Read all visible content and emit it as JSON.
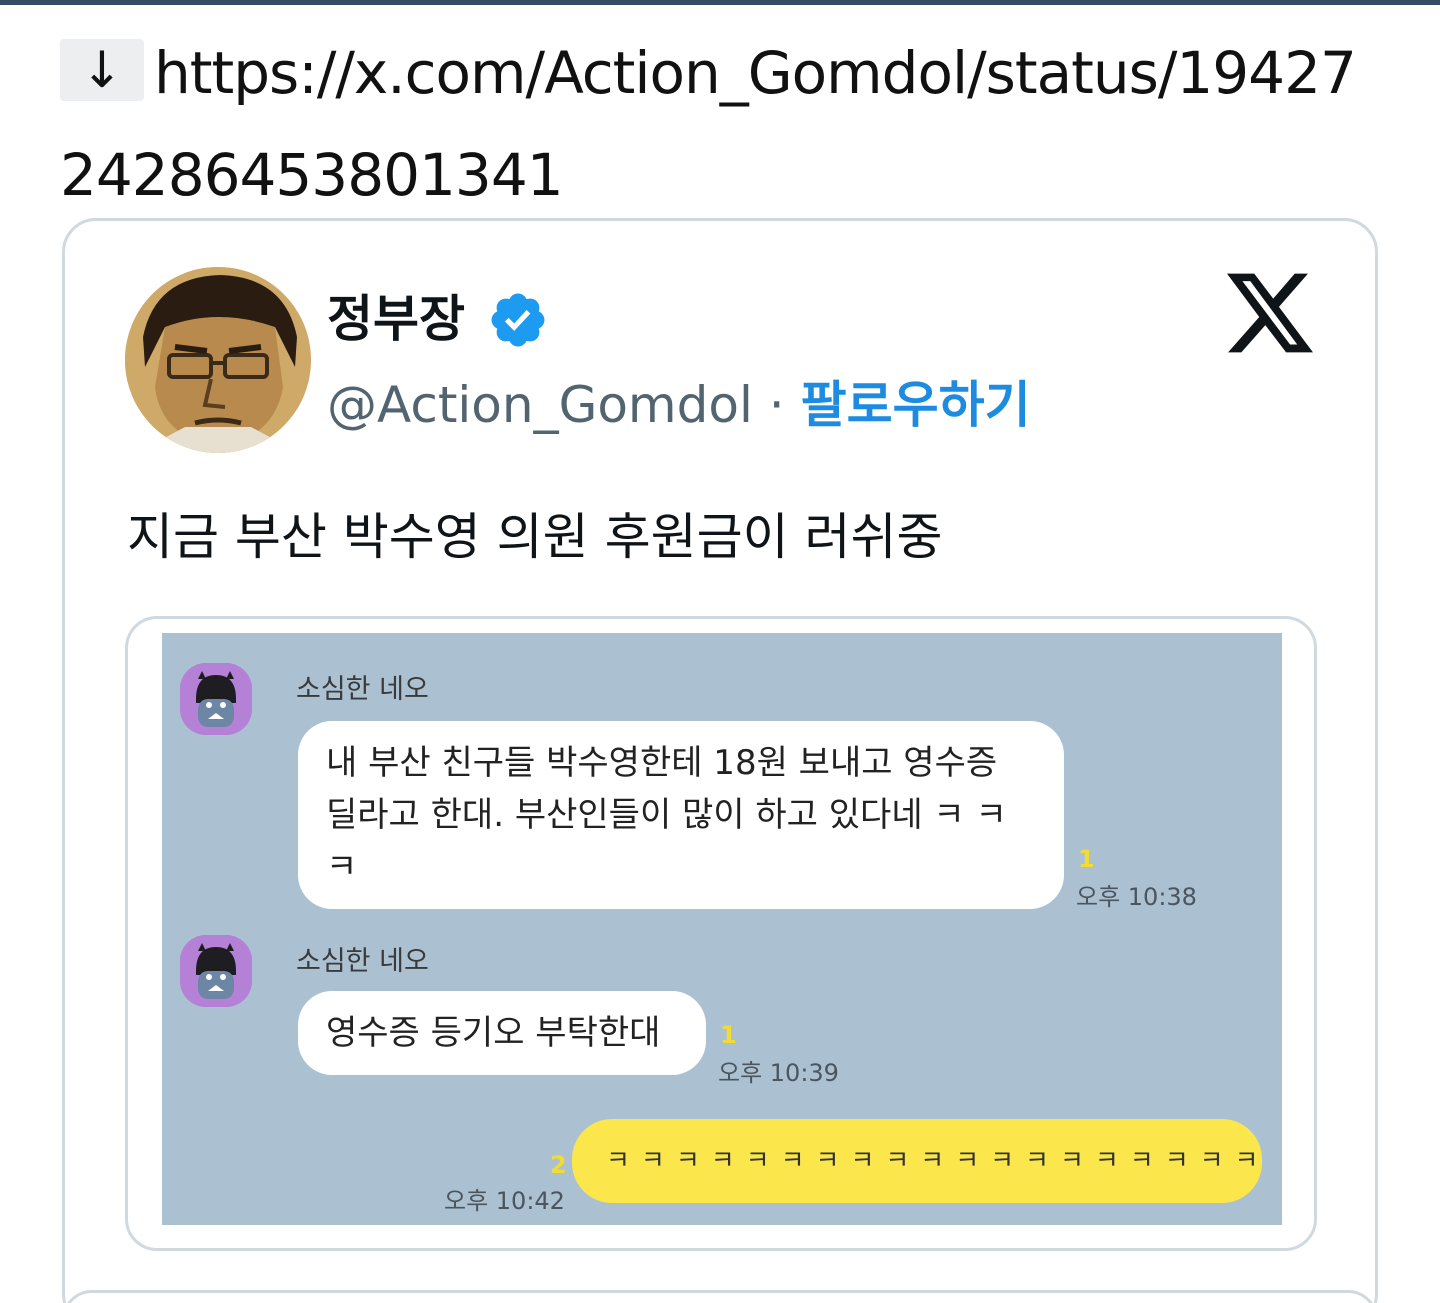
{
  "link": {
    "arrow_glyph": "↓",
    "url": "https://x.com/Action_Gomdol/status/1942724286453801341"
  },
  "tweet": {
    "author_name": "정부장",
    "handle": "@Action_Gomdol",
    "separator": "·",
    "follow_label": "팔로우하기",
    "text": "지금 부산 박수영 의원 후원금이 러쉬중",
    "verified_color": "#1d9bf0",
    "follow_color": "#1d8ce0"
  },
  "chat": {
    "background": "#abc1d1",
    "messages": [
      {
        "sender": "소심한 네오",
        "lines": [
          "내 부산 친구들 박수영한테 18원 보내고 영수증",
          "딜라고 한대. 부산인들이 많이 하고 있다네 ㅋ ㅋ",
          "ㅋ"
        ],
        "unread": "1",
        "time": "오후 10:38"
      },
      {
        "sender": "소심한 네오",
        "lines": [
          "영수증 등기오 부탁한대"
        ],
        "unread": "1",
        "time": "오후 10:39"
      },
      {
        "sender": "",
        "lines": [
          "ㅋㅋㅋㅋㅋㅋㅋㅋㅋㅋㅋㅋㅋㅋㅋㅋㅋㅋㅋ"
        ],
        "unread": "2",
        "time": "오후 10:42"
      }
    ]
  }
}
